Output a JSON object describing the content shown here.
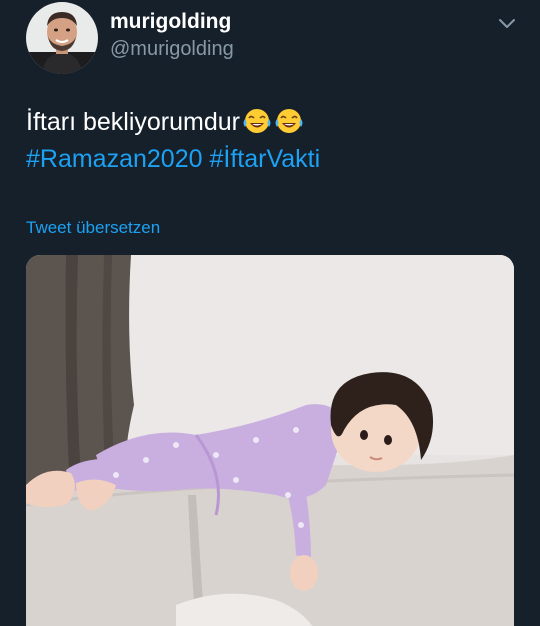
{
  "author": {
    "display_name": "murigolding",
    "handle": "@murigolding"
  },
  "tweet": {
    "line1_text": "İftarı bekliyorumdur",
    "emojis": [
      "face-with-tears-of-joy-icon",
      "face-with-tears-of-joy-icon"
    ],
    "hashtag1": "#Ramazan2020",
    "hashtag2": "#İftarVakti"
  },
  "translate_label": "Tweet übersetzen",
  "colors": {
    "background": "#15202b",
    "text": "#ffffff",
    "secondary_text": "#8899a6",
    "link": "#1da1f2"
  }
}
